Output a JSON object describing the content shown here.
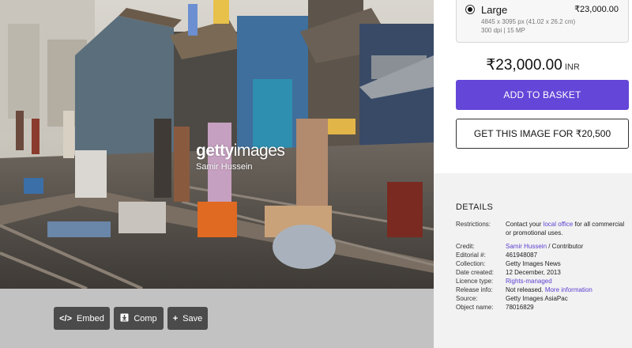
{
  "photo": {
    "watermark_logo_bold": "getty",
    "watermark_logo_light": "images",
    "watermark_credit": "Samir Hussein"
  },
  "toolbar": {
    "embed_icon": "</>",
    "embed_label": "Embed",
    "comp_icon": "download-icon",
    "comp_label": "Comp",
    "save_icon": "+",
    "save_label": "Save"
  },
  "size_option": {
    "name": "Large",
    "price": "₹23,000.00",
    "dimensions": "4845 x 3095 px (41.02 x 26.2 cm)",
    "meta": "300 dpi | 15 MP",
    "selected": true
  },
  "price": {
    "amount": "₹23,000.00",
    "currency": "INR"
  },
  "buttons": {
    "add_to_basket": "ADD TO BASKET",
    "get_image": "GET THIS IMAGE FOR ₹20,500"
  },
  "details": {
    "title": "DETAILS",
    "restrictions_label": "Restrictions:",
    "restrictions_pre": "Contact your ",
    "restrictions_link": "local office",
    "restrictions_post": " for all commercial or promotional uses.",
    "credit_label": "Credit:",
    "credit_link": "Samir Hussein",
    "credit_post": " / Contributor",
    "editorial_label": "Editorial #:",
    "editorial_value": "461948087",
    "collection_label": "Collection:",
    "collection_value": "Getty Images News",
    "date_label": "Date created:",
    "date_value": "12 December, 2013",
    "licence_label": "Licence type:",
    "licence_link": "Rights-managed",
    "release_label": "Release info:",
    "release_value": "Not released. ",
    "release_link": "More information",
    "source_label": "Source:",
    "source_value": "Getty Images AsiaPac",
    "object_label": "Object name:",
    "object_value": "78016829"
  },
  "colors": {
    "accent": "#6446d8",
    "link": "#5c3fd0",
    "toolbar_button": "#4b4b4b"
  }
}
